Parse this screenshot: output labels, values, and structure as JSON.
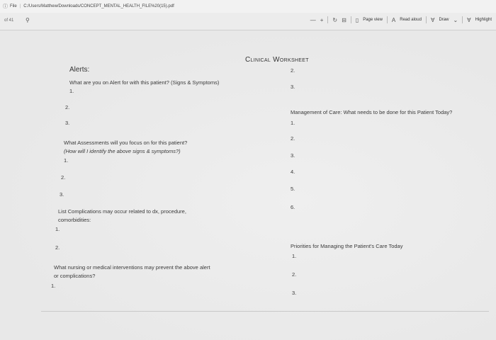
{
  "address_bar": {
    "file_label": "File",
    "path": "C:/Users/Matthew/Downloads/CONCEPT_MENTAL_HEALTH_FILE%20(15).pdf"
  },
  "pdf_toolbar": {
    "page_number": "of 41",
    "minus": "—",
    "plus": "+",
    "page_view": "Page view",
    "read_aloud": "Read aloud",
    "draw": "Draw",
    "highlight": "Highlight"
  },
  "document": {
    "title": "Clinical Worksheet",
    "left": {
      "alerts_heading": "Alerts:",
      "alerts_question": "What are you on Alert for with this patient? (Signs & Symptoms)",
      "alerts_items": [
        "1.",
        "2.",
        "3."
      ],
      "assessments_question_1": "What Assessments will you focus on for this patient?",
      "assessments_question_2": "(How will I identify the above signs & symptoms?)",
      "assessments_items": [
        "1.",
        "2.",
        "3."
      ],
      "complications_question_1": "List Complications may occur related to dx, procedure,",
      "complications_question_2": "comorbidities:",
      "complications_items": [
        "1.",
        "2."
      ],
      "interventions_question_1": "What nursing or medical interventions may prevent the above alert",
      "interventions_question_2": "or complications?",
      "interventions_items": [
        "1."
      ]
    },
    "right": {
      "top_items": [
        "2.",
        "3."
      ],
      "management_heading": "Management of Care: What needs to be done for this Patient Today?",
      "management_items": [
        "1.",
        "2.",
        "3.",
        "4.",
        "5.",
        "6."
      ],
      "priorities_heading": "Priorities for Managing the Patient's Care Today",
      "priorities_items": [
        "1.",
        "2.",
        "3."
      ]
    }
  }
}
